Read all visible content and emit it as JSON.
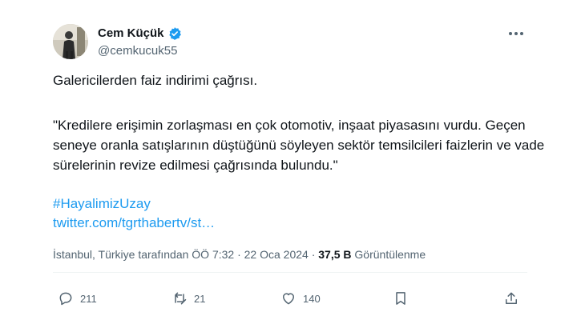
{
  "author": {
    "name": "Cem Küçük",
    "handle": "@cemkucuk55",
    "verified": true
  },
  "tweet": {
    "line1": "Galericilerden faiz indirimi çağrısı.",
    "quote": "\"Kredilere erişimin zorlaşması en çok otomotiv, inşaat piyasasını vurdu. Geçen seneye oranla satışlarının düştüğünü söyleyen sektör temsilcileri faizlerin ve vade sürelerinin revize edilmesi çağrısında bulundu.\"",
    "hashtag": "#HayalimizUzay",
    "link": "twitter.com/tgrthabertv/st…"
  },
  "meta": {
    "location_time": "İstanbul, Türkiye tarafından ÖÖ 7:32 · 22 Oca 2024 · ",
    "views_count": "37,5 B",
    "views_label": " Görüntülenme"
  },
  "actions": {
    "replies": "211",
    "retweets": "21",
    "likes": "140"
  },
  "colors": {
    "accent": "#1d9bf0",
    "secondary_text": "#536471",
    "divider": "#eff3f4"
  },
  "icons": [
    "verified-badge-icon",
    "more-icon",
    "reply-icon",
    "retweet-icon",
    "like-icon",
    "bookmark-icon",
    "share-icon"
  ]
}
